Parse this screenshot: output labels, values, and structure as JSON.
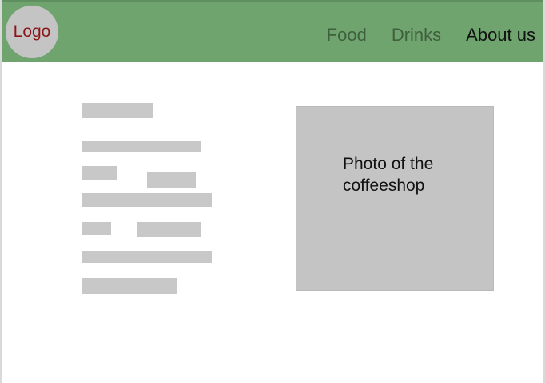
{
  "navbar": {
    "logo_label": "Logo",
    "links": [
      {
        "label": "Food"
      },
      {
        "label": "Drinks"
      },
      {
        "label": "About us"
      }
    ],
    "active_link": "About us"
  },
  "content": {
    "photo_caption": "Photo of the coffeeshop"
  },
  "colors": {
    "navbar_background": "#70a46f",
    "logo_background": "#c4c4c4",
    "logo_text": "#8b1416",
    "inactive_link": "#3f5f3e",
    "active_link": "#111111",
    "placeholder": "#c8c8c8",
    "photo_background": "#c4c4c4"
  }
}
